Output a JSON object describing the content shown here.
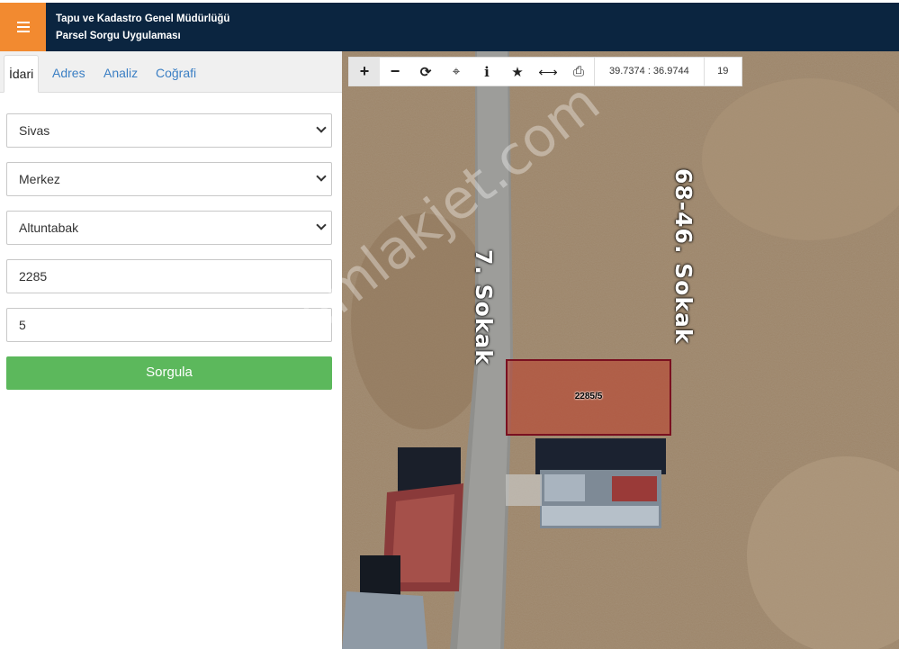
{
  "header": {
    "title_line1": "Tapu ve Kadastro Genel Müdürlüğü",
    "title_line2": "Parsel Sorgu Uygulaması",
    "menu_icon": "hamburger-icon",
    "accent_color": "#f28a30",
    "bg_color": "#0b2540"
  },
  "tabs": [
    {
      "label": "İdari",
      "active": true
    },
    {
      "label": "Adres",
      "active": false
    },
    {
      "label": "Analiz",
      "active": false
    },
    {
      "label": "Coğrafi",
      "active": false
    }
  ],
  "form": {
    "il": "Sivas",
    "ilce": "Merkez",
    "mahalle": "Altuntabak",
    "ada": "2285",
    "parsel": "5",
    "submit_label": "Sorgula",
    "submit_color": "#5cb85c"
  },
  "toolbar": {
    "tools": [
      "plus-icon",
      "minus-icon",
      "refresh-icon",
      "locate-icon",
      "info-icon",
      "star-icon",
      "measure-icon",
      "print-icon"
    ],
    "coordinates": "39.7374 : 36.9744",
    "zoom": "19"
  },
  "map": {
    "street_left": "7. Sokak",
    "street_right": "68-46. Sokak",
    "parcel_label": "2285/5",
    "watermark": "emlakjet.com"
  }
}
